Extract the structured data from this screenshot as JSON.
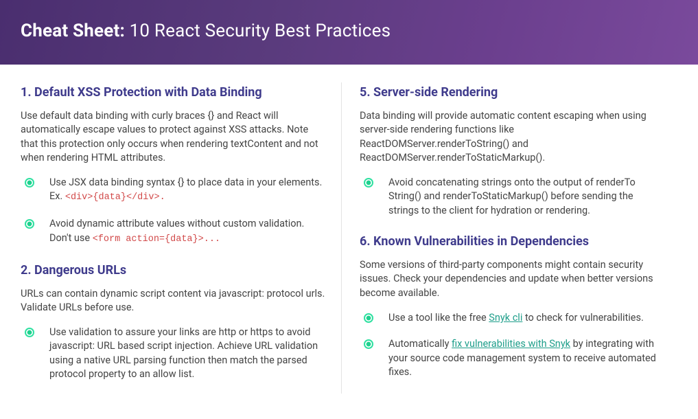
{
  "header": {
    "bold_part": "Cheat Sheet:",
    "rest": " 10 React Security Best Practices"
  },
  "left": {
    "s1": {
      "title": "1. Default XSS Protection with Data Binding",
      "desc": "Use default data binding with curly braces {} and React will automatically escape values to protect against XSS attacks. Note that this protection only occurs when rendering textContent and not when rendering HTML attributes.",
      "b1_pre": "Use JSX data binding syntax {} to place data in your elements. Ex. ",
      "b1_code": "<div>{data}</div>.",
      "b2_pre": "Avoid dynamic attribute values without custom validation. Don't use  ",
      "b2_code": "<form action={data}>..."
    },
    "s2": {
      "title": "2. Dangerous URLs",
      "desc": "URLs can contain dynamic script content via javascript: protocol urls. Validate URLs before use.",
      "b1": "Use validation to assure your links are http or https to avoid javascript: URL based script injection. Achieve URL validation using a native URL parsing function then match the parsed protocol property to an allow list."
    }
  },
  "right": {
    "s5": {
      "title": "5. Server-side Rendering",
      "desc": "Data binding will provide automatic content escaping when using server-side rendering functions like ReactDOMServer.renderToString() and ReactDOMServer.renderToStaticMarkup().",
      "b1": "Avoid concatenating strings onto the output of renderTo String() and renderToStaticMarkup() before sending the strings to the client for hydration or rendering."
    },
    "s6": {
      "title": "6. Known Vulnerabilities in Dependencies",
      "desc": "Some versions of third-party components might contain security issues. Check your dependencies and update when better versions become available.",
      "b1_pre": "Use a tool like the free ",
      "b1_link": "Snyk cli",
      "b1_post": " to check for vulnerabilities.",
      "b2_pre": "Automatically ",
      "b2_link": "fix vulnerabilities with Snyk",
      "b2_post": " by integrating with your source code management system to receive automated fixes."
    }
  }
}
